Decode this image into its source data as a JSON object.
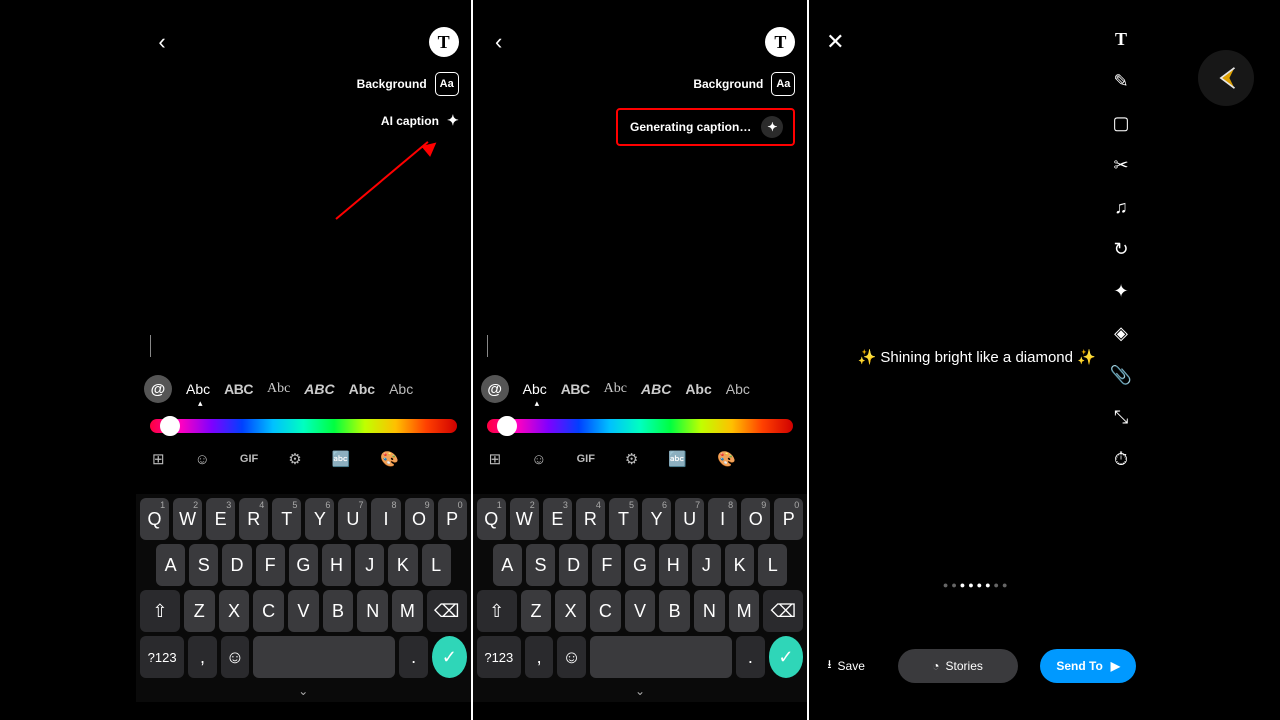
{
  "panel1": {
    "background_label": "Background",
    "aa_label": "Aa",
    "ai_caption_label": "AI caption"
  },
  "panel2": {
    "background_label": "Background",
    "aa_label": "Aa",
    "generating_label": "Generating caption…"
  },
  "panel3": {
    "result_caption": "✨ Shining bright like a diamond ✨",
    "save_label": "Save",
    "stories_label": "Stories",
    "sendto_label": "Send To"
  },
  "fontrow": {
    "at": "@",
    "styles": [
      "Abc",
      "ABC",
      "Abc",
      "ABC",
      "Abc",
      "Abc"
    ]
  },
  "keyboard": {
    "row1": [
      {
        "k": "Q",
        "s": "1"
      },
      {
        "k": "W",
        "s": "2"
      },
      {
        "k": "E",
        "s": "3"
      },
      {
        "k": "R",
        "s": "4"
      },
      {
        "k": "T",
        "s": "5"
      },
      {
        "k": "Y",
        "s": "6"
      },
      {
        "k": "U",
        "s": "7"
      },
      {
        "k": "I",
        "s": "8"
      },
      {
        "k": "O",
        "s": "9"
      },
      {
        "k": "P",
        "s": "0"
      }
    ],
    "row2": [
      "A",
      "S",
      "D",
      "F",
      "G",
      "H",
      "J",
      "K",
      "L"
    ],
    "row3": [
      "Z",
      "X",
      "C",
      "V",
      "B",
      "N",
      "M"
    ],
    "sym": "?123",
    "comma": ",",
    "dot": "."
  },
  "toolicons": [
    "⊞",
    "☺",
    "GIF",
    "⚙",
    "🔤",
    "🎨"
  ],
  "rtools": [
    "T",
    "✎",
    "▢",
    "✂",
    "♫",
    "↻",
    "✦",
    "◈",
    "📎",
    "⤡",
    "⏱"
  ]
}
